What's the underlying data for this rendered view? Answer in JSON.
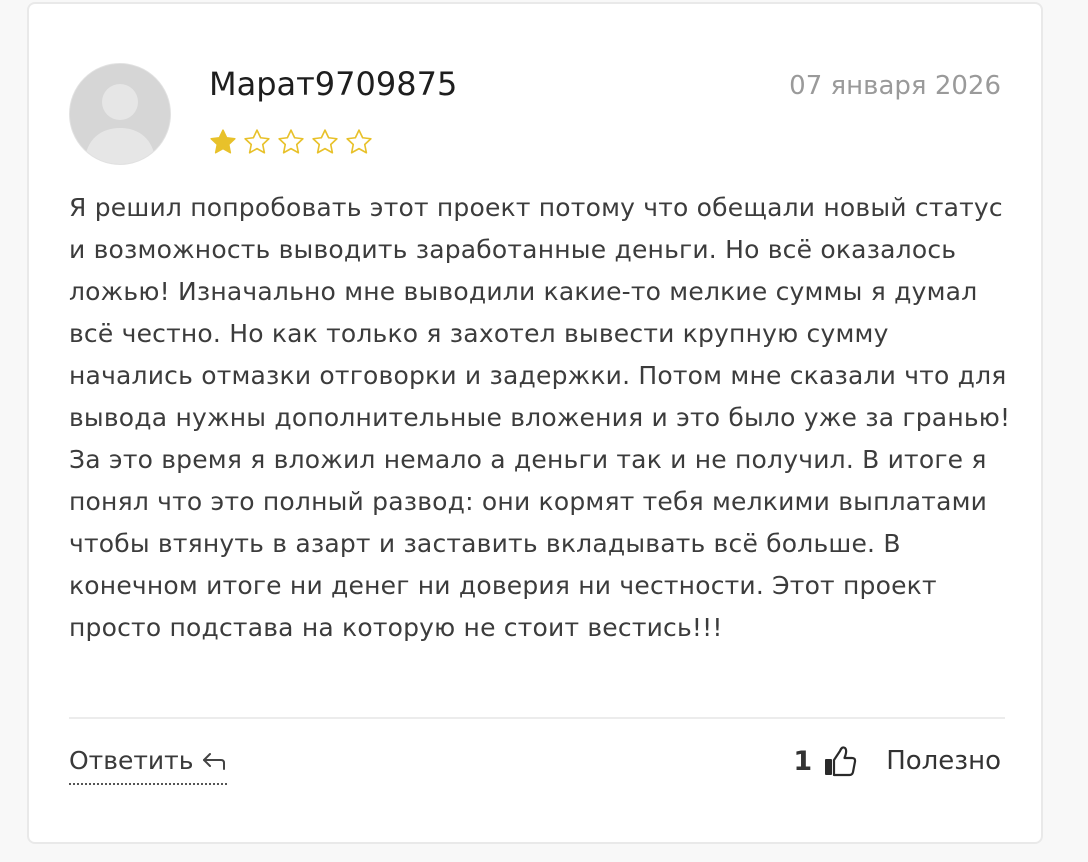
{
  "review": {
    "author": "Марат9709875",
    "date": "07 января 2026",
    "rating": 1,
    "rating_max": 5,
    "text": "Я решил попробовать этот проект потому что обещали новый статус и возможность выводить заработанные деньги. Но всё оказалось ложью! Изначально мне выводили какие-то мелкие суммы я думал всё честно. Но как только я захотел вывести крупную сумму начались отмазки отговорки и задержки. Потом мне сказали что для вывода нужны дополнительные вложения и это было уже за гранью! За это время я вложил немало а деньги так и не получил. В итоге я понял что это полный развод: они кормят тебя мелкими выплатами чтобы втянуть в азарт и заставить вкладывать всё больше. В конечном итоге ни денег ни доверия ни честности. Этот проект просто подстава на которую не стоит вестись!!!"
  },
  "actions": {
    "reply_label": "Ответить",
    "helpful_count": "1",
    "helpful_label": "Полезно"
  },
  "icons": {
    "avatar": "user-placeholder-icon",
    "star_filled": "star-filled-icon",
    "star_empty": "star-outline-icon",
    "reply": "reply-arrow-icon",
    "thumb": "thumbs-up-icon"
  },
  "colors": {
    "star": "#e8c12a",
    "text": "#3c3c3c",
    "muted": "#9a9a9a",
    "card_border": "#e9e9e9"
  }
}
